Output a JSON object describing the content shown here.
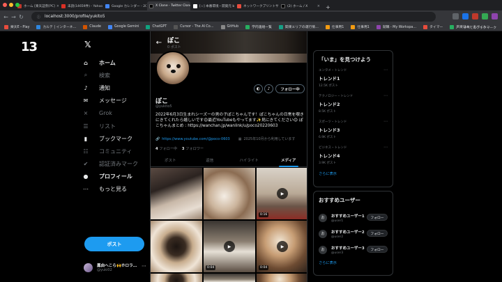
{
  "browser": {
    "tabs": [
      {
        "label": "ホーム [楽天証券[PC]",
        "color": "#c0392b"
      },
      {
        "label": "未読(14659件) - Yahoo!メール",
        "color": "#d93025"
      },
      {
        "label": "Google カレンダー - 2025年",
        "color": "#4285f4"
      },
      {
        "label": "X Clone - Twitter Clone App",
        "color": "#000000",
        "active": true
      },
      {
        "label": "[☆] 本番環境・開発元 by yu",
        "color": "#ffffff"
      },
      {
        "label": "ネットワークプリントサービス",
        "color": "#e84c3d"
      },
      {
        "label": "(2) ホーム / X",
        "color": "#000000"
      }
    ],
    "url": "localhost:3000/profile/yukito5",
    "bookmarks": [
      "楽天E・Play",
      "カルテ | インターネ…",
      "Claude",
      "Google Gemini",
      "ChatGPT",
      "Cursor - The AI Co…",
      "GitHub",
      "学内連絡一覧",
      "関東エリアの運行情…",
      "仕事用1",
      "仕事用1",
      "就職 - My Workspa…",
      "タイマー",
      "JR東日本：モバイル…"
    ],
    "bookmarks_all": "すべてのブックマーク"
  },
  "app": {
    "brand": "13",
    "x_logo": "𝕏",
    "nav": [
      {
        "label": "ホーム",
        "icon": "home-icon",
        "glyph": "⌂",
        "style": "bold"
      },
      {
        "label": "検索",
        "icon": "search-icon",
        "glyph": "⌕",
        "style": "dim"
      },
      {
        "label": "通知",
        "icon": "bell-icon",
        "glyph": "♪",
        "style": "normal"
      },
      {
        "label": "メッセージ",
        "icon": "mail-icon",
        "glyph": "✉",
        "style": "normal"
      },
      {
        "label": "Grok",
        "icon": "grok-icon",
        "glyph": "⨯",
        "style": "dim"
      },
      {
        "label": "リスト",
        "icon": "list-icon",
        "glyph": "☰",
        "style": "dim"
      },
      {
        "label": "ブックマーク",
        "icon": "bookmark-icon",
        "glyph": "▮",
        "style": "normal"
      },
      {
        "label": "コミュニティ",
        "icon": "community-icon",
        "glyph": "☷",
        "style": "dim"
      },
      {
        "label": "認証済みマーク",
        "icon": "verified-icon",
        "glyph": "✔",
        "style": "dim"
      },
      {
        "label": "プロフィール",
        "icon": "profile-icon",
        "glyph": "●",
        "style": "bold"
      },
      {
        "label": "もっと見る",
        "icon": "more-icon",
        "glyph": "⋯",
        "style": "normal"
      }
    ],
    "post_button": "ポスト",
    "account": {
      "name": "鳳由へこら🙌ホロラ…",
      "handle": "@yuki02",
      "more": "⋯"
    }
  },
  "profile": {
    "back": "←",
    "name": "ぽこ",
    "post_count": "0 ポスト",
    "handle": "@yukito5",
    "follow_button": "フォロー中",
    "bio": "2022年6月3日生まれシーズーの男の子ぽこちゃんです！ぽこちゃんの日常を覗きにきてくれたら嬉しいです😊最近YouTubeもやってます✨見にきてください😊 ぽこちゃんまとめ : https://wanchan.jp/wanlink/u/poco20220603",
    "link": "https://www.youtube.com/@poco-0603",
    "joined": "2025年10月から利用しています",
    "following_count": "4",
    "following_label": "フォロー中",
    "followers_count": "3",
    "followers_label": "フォロワー",
    "tabs": [
      "ポスト",
      "返信",
      "ハイライト",
      "メディア"
    ],
    "active_tab": "メディア",
    "media": [
      {
        "kind": "photo"
      },
      {
        "kind": "photo"
      },
      {
        "kind": "video",
        "duration": "0:16"
      },
      {
        "kind": "photo"
      },
      {
        "kind": "video",
        "duration": "0:04"
      },
      {
        "kind": "video",
        "duration": "0:04"
      }
    ]
  },
  "trends": {
    "title": "「いま」を見つけよう",
    "items": [
      {
        "category": "エンタメ・トレンド",
        "title": "トレンド1",
        "count": "12.5K ポスト"
      },
      {
        "category": "テクノロジー・トレンド",
        "title": "トレンド2",
        "count": "8.5K ポスト"
      },
      {
        "category": "スポーツ・トレンド",
        "title": "トレンド3",
        "count": "6.9K ポスト"
      },
      {
        "category": "ビジネス・トレンド",
        "title": "トレンド4",
        "count": "3.9K ポスト"
      }
    ],
    "more": "さらに表示"
  },
  "suggested": {
    "title": "おすすめユーザー",
    "users": [
      {
        "name": "おすすめユーザー1",
        "handle": "@user1",
        "initial": "お",
        "button": "フォロー"
      },
      {
        "name": "おすすめユーザー2",
        "handle": "@user2",
        "initial": "お",
        "button": "フォロー"
      },
      {
        "name": "おすすめユーザー3",
        "handle": "@user3",
        "initial": "お",
        "button": "フォロー"
      }
    ],
    "more": "さらに表示"
  }
}
